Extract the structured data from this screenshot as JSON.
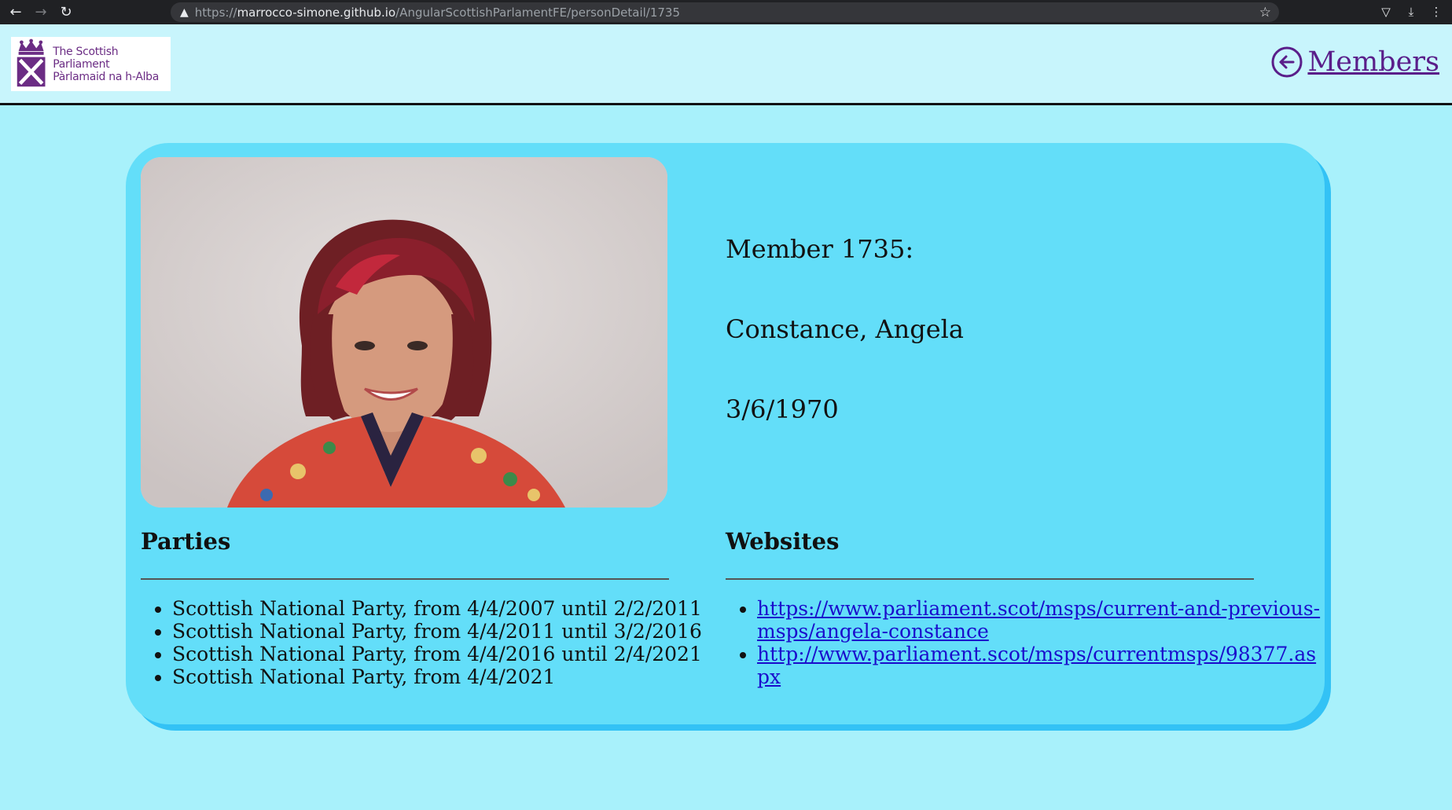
{
  "browser": {
    "url_scheme": "https://",
    "url_host": "marrocco-simone.github.io",
    "url_path": "/AngularScottishParlamentFE/personDetail/1735",
    "back_icon": "arrow-left-icon",
    "forward_icon": "arrow-right-icon",
    "reload_icon": "reload-icon",
    "star_icon": "star-icon",
    "pocket_icon": "pocket-icon",
    "download_icon": "download-icon",
    "menu_icon": "kebab-menu-icon"
  },
  "header": {
    "logo_line1": "The Scottish Parliament",
    "logo_line2": "Pàrlamaid na h-Alba",
    "members_link": "Members",
    "accent_color": "#5a1e8a"
  },
  "member": {
    "id_line": "Member 1735:",
    "name": "Constance, Angela",
    "birth_date": "3/6/1970"
  },
  "parties": {
    "title": "Parties",
    "items": [
      "Scottish National Party, from 4/4/2007 until 2/2/2011",
      "Scottish National Party, from 4/4/2011 until 3/2/2016",
      "Scottish National Party, from 4/4/2016 until 2/4/2021",
      "Scottish National Party, from 4/4/2021"
    ]
  },
  "websites": {
    "title": "Websites",
    "items": [
      "https://www.parliament.scot/msps/current-and-previous-msps/angela-constance",
      "http://www.parliament.scot/msps/currentmsps/98377.aspx"
    ]
  },
  "colors": {
    "page_bg": "#a8f1fb",
    "header_bg": "#c8f5fc",
    "card_bg": "#63def9",
    "card_shadow": "#33c2f5",
    "link": "#1a0dcc"
  }
}
